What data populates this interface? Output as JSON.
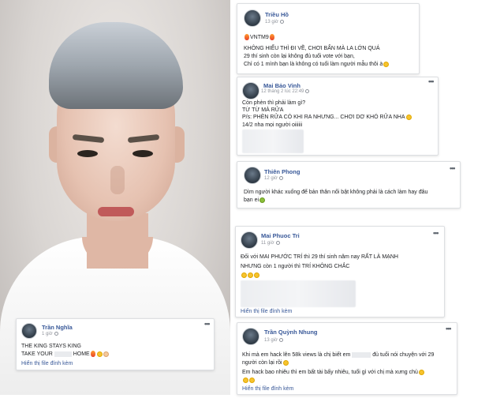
{
  "comments": [
    {
      "name": "Triều Hồ",
      "time": "13 giờ",
      "lines": [
        "VNTM9",
        "KHÔNG HIỂU THÌ ĐI VỀ, CHƠI BẨN MÀ LA LỚN QUÁ",
        "29 thí sinh còn lại không đủ tuổi vote với bạn,",
        "Chỉ có 1 mình bạn là không có tuổi làm người mẫu thôi à"
      ]
    },
    {
      "name": "Mai Bảo Vinh",
      "time": "12 tháng 2 lúc 22:49",
      "lines": [
        "Còn phèn thì phải làm gì?",
        "TỪ TỪ MÀ RỬA",
        "P/s: PHÈN RỬA CÓ KHI RA NHƯNG... CHƠI DƠ KHÓ RỬA NHA",
        "14/2 nha mọi người oiiiiii"
      ]
    },
    {
      "name": "Thiên Phong",
      "time": "12 giờ",
      "lines": [
        "Dìm người khác xuống để bản thân nổi bật không phải là cách làm hay đâu",
        "bạn ei"
      ]
    },
    {
      "name": "Mai Phuoc Tri",
      "time": "11 giờ",
      "lines": [
        "Đối với MAI PHƯỚC TRÍ thì 29 thí sinh năm nay RẤT LÀ MẠNH",
        "NHƯNG còn 1 người thì TRÍ KHÔNG CHẮC"
      ],
      "attachment_link": "Hiển thị file đính kèm"
    },
    {
      "name": "Trần Quỳnh Nhung",
      "time": "13 giờ",
      "lines": [
        "Khi mà em hack lên 58k views là chị biết em",
        "đủ tuổi nói chuyện với 29",
        "người còn lại rồi",
        "Em hack bao nhiêu thì em bất tài bấy nhiêu, tuổi gì với chị mà xưng chủ"
      ],
      "attachment_link": "Hiển thị file đính kèm"
    },
    {
      "name": "Trần Nghĩa",
      "time": "1 giờ",
      "lines": [
        "THE KING STAYS KING",
        "TAKE YOUR",
        "HOME"
      ],
      "attachment_link": "Hiển thị file đính kèm"
    }
  ],
  "colors": {
    "name": "#385898",
    "meta": "#90949c",
    "border": "#dddfe2"
  }
}
